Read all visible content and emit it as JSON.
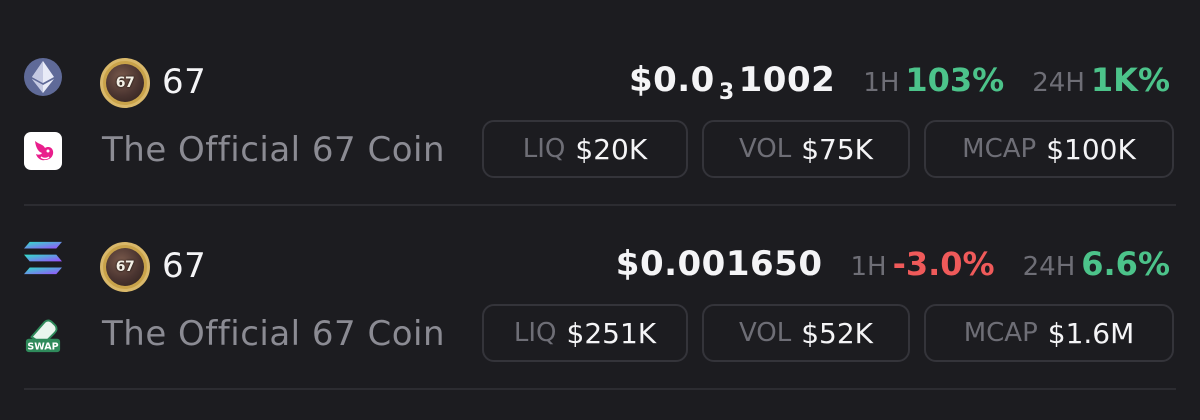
{
  "rows": [
    {
      "chain_icon": "ethereum-icon",
      "dex_icon": "uniswap-icon",
      "avatar_text": "67",
      "symbol": "67",
      "name": "The Official 67 Coin",
      "price_prefix": "$0.0",
      "price_zero_count": "3",
      "price_suffix": "1002",
      "tf1": "1H",
      "chg1": "103%",
      "tf2": "24H",
      "chg2": "1K%",
      "liq_label": "LIQ",
      "liq": "$20K",
      "vol_label": "VOL",
      "vol": "$75K",
      "mcap_label": "MCAP",
      "mcap": "$100K"
    },
    {
      "chain_icon": "solana-icon",
      "dex_icon": "swap-icon",
      "dex_badge": "SWAP",
      "avatar_text": "67",
      "symbol": "67",
      "name": "The Official 67 Coin",
      "price": "$0.001650",
      "tf1": "1H",
      "chg1": "-3.0%",
      "tf2": "24H",
      "chg2": "6.6%",
      "liq_label": "LIQ",
      "liq": "$251K",
      "vol_label": "VOL",
      "vol": "$52K",
      "mcap_label": "MCAP",
      "mcap": "$1.6M"
    }
  ],
  "colors": {
    "background": "#1c1c20",
    "positive": "#4cc38a",
    "negative": "#ef5a5a",
    "muted": "#6e6e76",
    "name": "#8b8b93",
    "pill_border": "#34343a",
    "uniswap_pink": "#e91e8c",
    "swap_green": "#2f8a5b"
  }
}
